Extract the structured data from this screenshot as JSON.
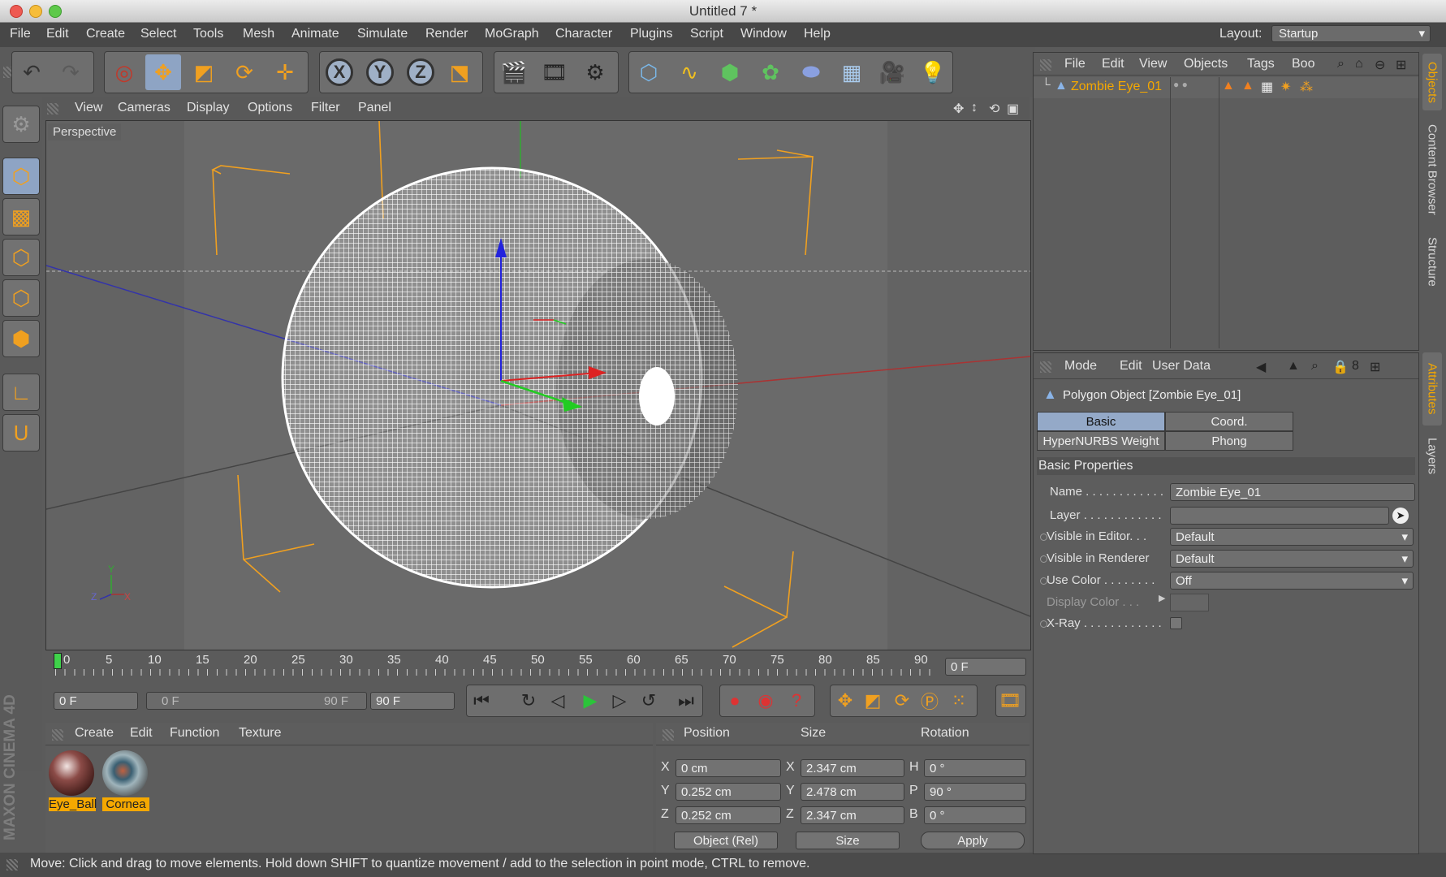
{
  "window": {
    "title": "Untitled 7 *"
  },
  "menubar": {
    "items": [
      "File",
      "Edit",
      "Create",
      "Select",
      "Tools",
      "Mesh",
      "Animate",
      "Simulate",
      "Render",
      "MoGraph",
      "Character",
      "Plugins",
      "Script",
      "Window",
      "Help"
    ],
    "layout_label": "Layout:",
    "layout_value": "Startup"
  },
  "viewport": {
    "menu": [
      "View",
      "Cameras",
      "Display",
      "Options",
      "Filter",
      "Panel"
    ],
    "label": "Perspective",
    "axis": {
      "y": "Y",
      "z": "Z",
      "x": "X"
    }
  },
  "timeline": {
    "ticks": [
      "0",
      "5",
      "10",
      "15",
      "20",
      "25",
      "30",
      "35",
      "40",
      "45",
      "50",
      "55",
      "60",
      "65",
      "70",
      "75",
      "80",
      "85",
      "90"
    ],
    "current": "0 F"
  },
  "transport": {
    "start": "0 F",
    "range_start": "0 F",
    "range_end": "90 F",
    "end": "90 F"
  },
  "material_manager": {
    "menu": [
      "Create",
      "Edit",
      "Function",
      "Texture"
    ],
    "materials": [
      {
        "name": "Eye_Ball"
      },
      {
        "name": "Cornea"
      }
    ]
  },
  "coordinate_manager": {
    "headers": {
      "position": "Position",
      "size": "Size",
      "rotation": "Rotation"
    },
    "rows": [
      {
        "axis": "X",
        "pos": "0 cm",
        "size_axis": "X",
        "size": "2.347 cm",
        "rot_axis": "H",
        "rot": "0 °"
      },
      {
        "axis": "Y",
        "pos": "0.252 cm",
        "size_axis": "Y",
        "size": "2.478 cm",
        "rot_axis": "P",
        "rot": "90 °"
      },
      {
        "axis": "Z",
        "pos": "0.252 cm",
        "size_axis": "Z",
        "size": "2.347 cm",
        "rot_axis": "B",
        "rot": "0 °"
      }
    ],
    "mode": "Object (Rel)",
    "size_mode": "Size",
    "apply": "Apply"
  },
  "object_manager": {
    "menu": [
      "File",
      "Edit",
      "View",
      "Objects",
      "Tags",
      "Boo"
    ],
    "object_name": "Zombie Eye_01"
  },
  "attribute_manager": {
    "menu": [
      "Mode",
      "Edit",
      "User Data"
    ],
    "title": "Polygon Object [Zombie Eye_01]",
    "tabs": [
      "Basic",
      "Coord.",
      "HyperNURBS Weight",
      "Phong"
    ],
    "section": "Basic Properties",
    "props": {
      "name_label": "Name . . . . . . . . . . . .",
      "name_value": "Zombie Eye_01",
      "layer_label": "Layer . . . . . . . . . . . .",
      "vis_editor_label": "Visible in Editor. . .",
      "vis_editor_value": "Default",
      "vis_render_label": "Visible in Renderer",
      "vis_render_value": "Default",
      "use_color_label": "Use Color . . . . . . . .",
      "use_color_value": "Off",
      "display_color_label": "Display Color . . .",
      "xray_label": "X-Ray . . . . . . . . . . . ."
    }
  },
  "side_tabs": [
    "Objects",
    "Content Browser",
    "Structure",
    "Attributes",
    "Layers"
  ],
  "brand": "MAXON CINEMA 4D",
  "status": "Move: Click and drag to move elements. Hold down SHIFT to quantize movement / add to the selection in point mode, CTRL to remove."
}
